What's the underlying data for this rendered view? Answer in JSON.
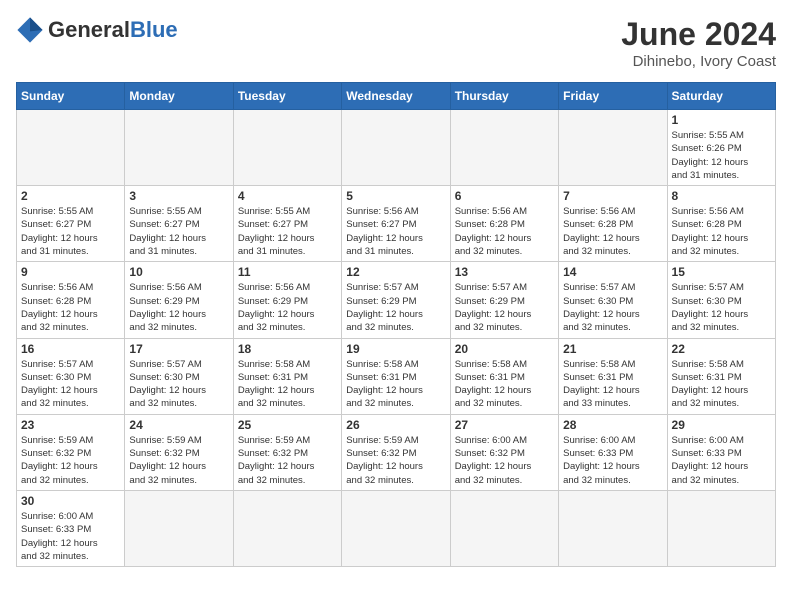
{
  "header": {
    "logo_general": "General",
    "logo_blue": "Blue",
    "title": "June 2024",
    "subtitle": "Dihinebo, Ivory Coast"
  },
  "days_of_week": [
    "Sunday",
    "Monday",
    "Tuesday",
    "Wednesday",
    "Thursday",
    "Friday",
    "Saturday"
  ],
  "weeks": [
    [
      {
        "day": null,
        "info": null
      },
      {
        "day": null,
        "info": null
      },
      {
        "day": null,
        "info": null
      },
      {
        "day": null,
        "info": null
      },
      {
        "day": null,
        "info": null
      },
      {
        "day": null,
        "info": null
      },
      {
        "day": "1",
        "info": "Sunrise: 5:55 AM\nSunset: 6:26 PM\nDaylight: 12 hours\nand 31 minutes."
      }
    ],
    [
      {
        "day": "2",
        "info": "Sunrise: 5:55 AM\nSunset: 6:27 PM\nDaylight: 12 hours\nand 31 minutes."
      },
      {
        "day": "3",
        "info": "Sunrise: 5:55 AM\nSunset: 6:27 PM\nDaylight: 12 hours\nand 31 minutes."
      },
      {
        "day": "4",
        "info": "Sunrise: 5:55 AM\nSunset: 6:27 PM\nDaylight: 12 hours\nand 31 minutes."
      },
      {
        "day": "5",
        "info": "Sunrise: 5:56 AM\nSunset: 6:27 PM\nDaylight: 12 hours\nand 31 minutes."
      },
      {
        "day": "6",
        "info": "Sunrise: 5:56 AM\nSunset: 6:28 PM\nDaylight: 12 hours\nand 32 minutes."
      },
      {
        "day": "7",
        "info": "Sunrise: 5:56 AM\nSunset: 6:28 PM\nDaylight: 12 hours\nand 32 minutes."
      },
      {
        "day": "8",
        "info": "Sunrise: 5:56 AM\nSunset: 6:28 PM\nDaylight: 12 hours\nand 32 minutes."
      }
    ],
    [
      {
        "day": "9",
        "info": "Sunrise: 5:56 AM\nSunset: 6:28 PM\nDaylight: 12 hours\nand 32 minutes."
      },
      {
        "day": "10",
        "info": "Sunrise: 5:56 AM\nSunset: 6:29 PM\nDaylight: 12 hours\nand 32 minutes."
      },
      {
        "day": "11",
        "info": "Sunrise: 5:56 AM\nSunset: 6:29 PM\nDaylight: 12 hours\nand 32 minutes."
      },
      {
        "day": "12",
        "info": "Sunrise: 5:57 AM\nSunset: 6:29 PM\nDaylight: 12 hours\nand 32 minutes."
      },
      {
        "day": "13",
        "info": "Sunrise: 5:57 AM\nSunset: 6:29 PM\nDaylight: 12 hours\nand 32 minutes."
      },
      {
        "day": "14",
        "info": "Sunrise: 5:57 AM\nSunset: 6:30 PM\nDaylight: 12 hours\nand 32 minutes."
      },
      {
        "day": "15",
        "info": "Sunrise: 5:57 AM\nSunset: 6:30 PM\nDaylight: 12 hours\nand 32 minutes."
      }
    ],
    [
      {
        "day": "16",
        "info": "Sunrise: 5:57 AM\nSunset: 6:30 PM\nDaylight: 12 hours\nand 32 minutes."
      },
      {
        "day": "17",
        "info": "Sunrise: 5:57 AM\nSunset: 6:30 PM\nDaylight: 12 hours\nand 32 minutes."
      },
      {
        "day": "18",
        "info": "Sunrise: 5:58 AM\nSunset: 6:31 PM\nDaylight: 12 hours\nand 32 minutes."
      },
      {
        "day": "19",
        "info": "Sunrise: 5:58 AM\nSunset: 6:31 PM\nDaylight: 12 hours\nand 32 minutes."
      },
      {
        "day": "20",
        "info": "Sunrise: 5:58 AM\nSunset: 6:31 PM\nDaylight: 12 hours\nand 32 minutes."
      },
      {
        "day": "21",
        "info": "Sunrise: 5:58 AM\nSunset: 6:31 PM\nDaylight: 12 hours\nand 33 minutes."
      },
      {
        "day": "22",
        "info": "Sunrise: 5:58 AM\nSunset: 6:31 PM\nDaylight: 12 hours\nand 32 minutes."
      }
    ],
    [
      {
        "day": "23",
        "info": "Sunrise: 5:59 AM\nSunset: 6:32 PM\nDaylight: 12 hours\nand 32 minutes."
      },
      {
        "day": "24",
        "info": "Sunrise: 5:59 AM\nSunset: 6:32 PM\nDaylight: 12 hours\nand 32 minutes."
      },
      {
        "day": "25",
        "info": "Sunrise: 5:59 AM\nSunset: 6:32 PM\nDaylight: 12 hours\nand 32 minutes."
      },
      {
        "day": "26",
        "info": "Sunrise: 5:59 AM\nSunset: 6:32 PM\nDaylight: 12 hours\nand 32 minutes."
      },
      {
        "day": "27",
        "info": "Sunrise: 6:00 AM\nSunset: 6:32 PM\nDaylight: 12 hours\nand 32 minutes."
      },
      {
        "day": "28",
        "info": "Sunrise: 6:00 AM\nSunset: 6:33 PM\nDaylight: 12 hours\nand 32 minutes."
      },
      {
        "day": "29",
        "info": "Sunrise: 6:00 AM\nSunset: 6:33 PM\nDaylight: 12 hours\nand 32 minutes."
      }
    ],
    [
      {
        "day": "30",
        "info": "Sunrise: 6:00 AM\nSunset: 6:33 PM\nDaylight: 12 hours\nand 32 minutes."
      },
      {
        "day": null,
        "info": null
      },
      {
        "day": null,
        "info": null
      },
      {
        "day": null,
        "info": null
      },
      {
        "day": null,
        "info": null
      },
      {
        "day": null,
        "info": null
      },
      {
        "day": null,
        "info": null
      }
    ]
  ]
}
